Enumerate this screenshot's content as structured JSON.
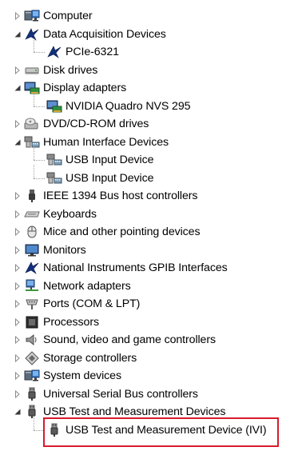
{
  "tree": [
    {
      "label": "Computer",
      "icon": "computer-icon",
      "level": 0,
      "state": "collapsed"
    },
    {
      "label": "Data Acquisition Devices",
      "icon": "ni-logo-icon",
      "level": 0,
      "state": "expanded"
    },
    {
      "label": "PCIe-6321",
      "icon": "ni-logo-icon",
      "level": 1,
      "state": "leaf"
    },
    {
      "label": "Disk drives",
      "icon": "disk-drive-icon",
      "level": 0,
      "state": "collapsed"
    },
    {
      "label": "Display adapters",
      "icon": "display-adapter-icon",
      "level": 0,
      "state": "expanded"
    },
    {
      "label": "NVIDIA Quadro NVS 295",
      "icon": "display-adapter-icon",
      "level": 1,
      "state": "leaf"
    },
    {
      "label": "DVD/CD-ROM drives",
      "icon": "dvd-drive-icon",
      "level": 0,
      "state": "collapsed"
    },
    {
      "label": "Human Interface Devices",
      "icon": "hid-icon",
      "level": 0,
      "state": "expanded"
    },
    {
      "label": "USB Input Device",
      "icon": "hid-icon",
      "level": 1,
      "state": "leaf"
    },
    {
      "label": "USB Input Device",
      "icon": "hid-icon",
      "level": 1,
      "state": "leaf"
    },
    {
      "label": "IEEE 1394 Bus host controllers",
      "icon": "ieee1394-icon",
      "level": 0,
      "state": "collapsed"
    },
    {
      "label": "Keyboards",
      "icon": "keyboard-icon",
      "level": 0,
      "state": "collapsed"
    },
    {
      "label": "Mice and other pointing devices",
      "icon": "mouse-icon",
      "level": 0,
      "state": "collapsed"
    },
    {
      "label": "Monitors",
      "icon": "monitor-icon",
      "level": 0,
      "state": "collapsed"
    },
    {
      "label": "National Instruments GPIB Interfaces",
      "icon": "ni-logo-icon",
      "level": 0,
      "state": "collapsed"
    },
    {
      "label": "Network adapters",
      "icon": "network-adapter-icon",
      "level": 0,
      "state": "collapsed"
    },
    {
      "label": "Ports (COM & LPT)",
      "icon": "port-icon",
      "level": 0,
      "state": "collapsed"
    },
    {
      "label": "Processors",
      "icon": "processor-icon",
      "level": 0,
      "state": "collapsed"
    },
    {
      "label": "Sound, video and game controllers",
      "icon": "speaker-icon",
      "level": 0,
      "state": "collapsed"
    },
    {
      "label": "Storage controllers",
      "icon": "storage-controller-icon",
      "level": 0,
      "state": "collapsed"
    },
    {
      "label": "System devices",
      "icon": "computer-icon",
      "level": 0,
      "state": "collapsed"
    },
    {
      "label": "Universal Serial Bus controllers",
      "icon": "usb-icon",
      "level": 0,
      "state": "collapsed"
    },
    {
      "label": "USB Test and Measurement Devices",
      "icon": "usb-icon",
      "level": 0,
      "state": "expanded"
    },
    {
      "label": "USB Test and Measurement Device (IVI)",
      "icon": "usb-icon",
      "level": 1,
      "state": "leaf",
      "highlighted": true
    }
  ],
  "colors": {
    "highlight_border": "#d81b2b",
    "tree_line": "#a0a0a0",
    "text": "#000000"
  }
}
